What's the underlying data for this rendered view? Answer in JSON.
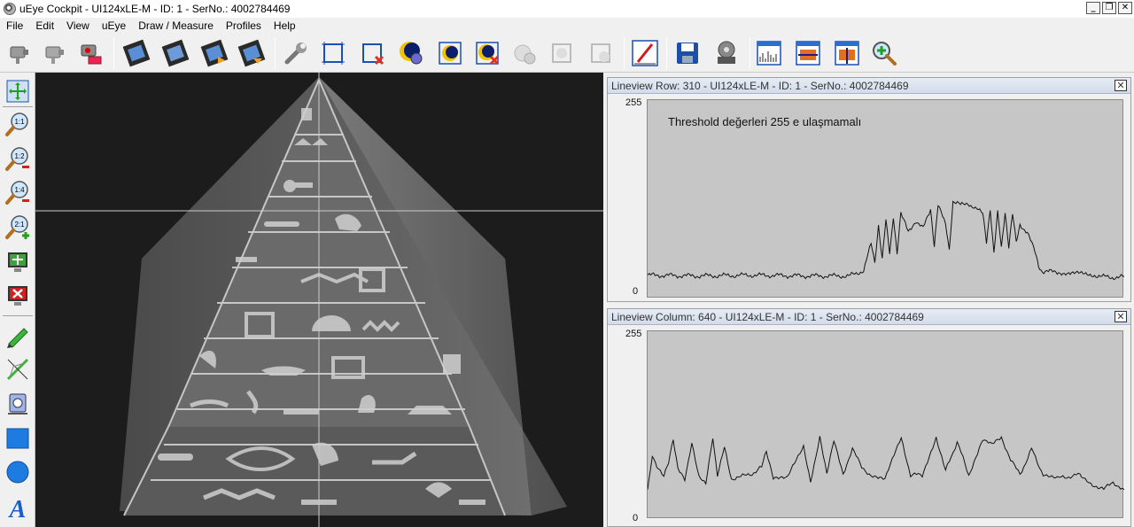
{
  "window": {
    "title": "uEye Cockpit - UI124xLE-M - ID: 1 - SerNo.: 4002784469"
  },
  "menu": [
    "File",
    "Edit",
    "View",
    "uEye",
    "Draw / Measure",
    "Profiles",
    "Help"
  ],
  "toolbar_icons": [
    "open-camera-icon",
    "close-camera-icon",
    "camera-settings-icon",
    "live-video-icon",
    "freeze-video-icon",
    "record-video-icon",
    "video-export-icon",
    "wrench-icon",
    "aoi-icon",
    "aoi-delete-icon",
    "auto-exposure-icon",
    "auto-white-balance-icon",
    "auto-gain-off-icon",
    "parameter-icon",
    "aoi-fit-icon",
    "aoi-overlay-icon",
    "edge-enhance-icon",
    "save-image-icon",
    "video-reel-icon",
    "histogram-icon",
    "lineview-row-icon",
    "lineview-column-icon",
    "zoom-magnifier-icon"
  ],
  "left_tools": [
    {
      "name": "fit-window-icon",
      "label": ""
    },
    {
      "name": "zoom-1-1-icon",
      "label": "1:1"
    },
    {
      "name": "zoom-1-2-icon",
      "label": "1:2"
    },
    {
      "name": "zoom-1-4-icon",
      "label": "1:4"
    },
    {
      "name": "zoom-2-1-icon",
      "label": "2:1"
    },
    {
      "name": "show-overlay-icon",
      "label": ""
    },
    {
      "name": "clear-overlay-icon",
      "label": ""
    },
    {
      "name": "pencil-icon",
      "label": ""
    },
    {
      "name": "line-tool-icon",
      "label": ""
    },
    {
      "name": "eraser-icon",
      "label": ""
    },
    {
      "name": "rectangle-icon",
      "label": ""
    },
    {
      "name": "circle-icon",
      "label": ""
    },
    {
      "name": "text-tool-icon",
      "label": "A"
    }
  ],
  "lineview_row": {
    "title": "Lineview Row: 310 - UI124xLE-M - ID: 1 - SerNo.: 4002784469",
    "y_max_label": "255",
    "y_min_label": "0",
    "annotation": "Threshold değerleri 255 e ulaşmamalı"
  },
  "lineview_column": {
    "title": "Lineview Column: 640 - UI124xLE-M - ID: 1 - SerNo.: 4002784469",
    "y_max_label": "255",
    "y_min_label": "0"
  },
  "colors": {
    "plot_bg": "#c6c6c6",
    "trace": "#111111",
    "camera_bg": "#1c1c1c",
    "panel_header": "#d3dcea"
  },
  "chart_data": [
    {
      "type": "line",
      "title": "",
      "ylim": [
        0,
        255
      ],
      "xlim": [
        0,
        1280
      ],
      "y_ticks": [
        0,
        255
      ],
      "grid": false,
      "series": [
        {
          "values": [
            [
              0,
              30
            ],
            [
              140,
              29
            ],
            [
              280,
              30
            ],
            [
              420,
              29
            ],
            [
              540,
              29
            ],
            [
              560,
              32
            ],
            [
              580,
              36
            ],
            [
              600,
              70
            ],
            [
              610,
              45
            ],
            [
              620,
              95
            ],
            [
              630,
              50
            ],
            [
              640,
              100
            ],
            [
              650,
              60
            ],
            [
              660,
              105
            ],
            [
              670,
              55
            ],
            [
              680,
              110
            ],
            [
              700,
              85
            ],
            [
              720,
              100
            ],
            [
              740,
              90
            ],
            [
              760,
              115
            ],
            [
              770,
              65
            ],
            [
              780,
              120
            ],
            [
              800,
              95
            ],
            [
              810,
              60
            ],
            [
              820,
              125
            ],
            [
              840,
              120
            ],
            [
              860,
              123
            ],
            [
              880,
              115
            ],
            [
              900,
              110
            ],
            [
              910,
              70
            ],
            [
              920,
              115
            ],
            [
              930,
              60
            ],
            [
              940,
              110
            ],
            [
              950,
              65
            ],
            [
              960,
              112
            ],
            [
              970,
              65
            ],
            [
              980,
              108
            ],
            [
              990,
              75
            ],
            [
              1000,
              95
            ],
            [
              1020,
              85
            ],
            [
              1040,
              60
            ],
            [
              1050,
              40
            ],
            [
              1060,
              35
            ],
            [
              1100,
              34
            ],
            [
              1150,
              32
            ],
            [
              1200,
              30
            ],
            [
              1240,
              27
            ],
            [
              1280,
              28
            ]
          ]
        }
      ]
    },
    {
      "type": "line",
      "title": "",
      "ylim": [
        0,
        255
      ],
      "xlim": [
        0,
        1024
      ],
      "y_ticks": [
        0,
        255
      ],
      "grid": false,
      "series": [
        {
          "values": [
            [
              0,
              40
            ],
            [
              10,
              88
            ],
            [
              20,
              70
            ],
            [
              35,
              58
            ],
            [
              45,
              75
            ],
            [
              55,
              110
            ],
            [
              65,
              70
            ],
            [
              80,
              55
            ],
            [
              95,
              105
            ],
            [
              110,
              60
            ],
            [
              125,
              50
            ],
            [
              140,
              112
            ],
            [
              150,
              60
            ],
            [
              165,
              100
            ],
            [
              180,
              55
            ],
            [
              220,
              60
            ],
            [
              245,
              70
            ],
            [
              255,
              92
            ],
            [
              270,
              55
            ],
            [
              300,
              55
            ],
            [
              335,
              100
            ],
            [
              350,
              52
            ],
            [
              370,
              110
            ],
            [
              385,
              60
            ],
            [
              400,
              105
            ],
            [
              420,
              62
            ],
            [
              440,
              95
            ],
            [
              460,
              70
            ],
            [
              480,
              60
            ],
            [
              510,
              55
            ],
            [
              545,
              110
            ],
            [
              565,
              60
            ],
            [
              590,
              60
            ],
            [
              620,
              112
            ],
            [
              640,
              65
            ],
            [
              665,
              105
            ],
            [
              690,
              60
            ],
            [
              720,
              110
            ],
            [
              740,
              100
            ],
            [
              760,
              112
            ],
            [
              780,
              80
            ],
            [
              800,
              60
            ],
            [
              825,
              95
            ],
            [
              850,
              60
            ],
            [
              880,
              55
            ],
            [
              925,
              60
            ],
            [
              940,
              52
            ],
            [
              980,
              40
            ],
            [
              1000,
              50
            ],
            [
              1024,
              40
            ]
          ]
        }
      ]
    }
  ]
}
